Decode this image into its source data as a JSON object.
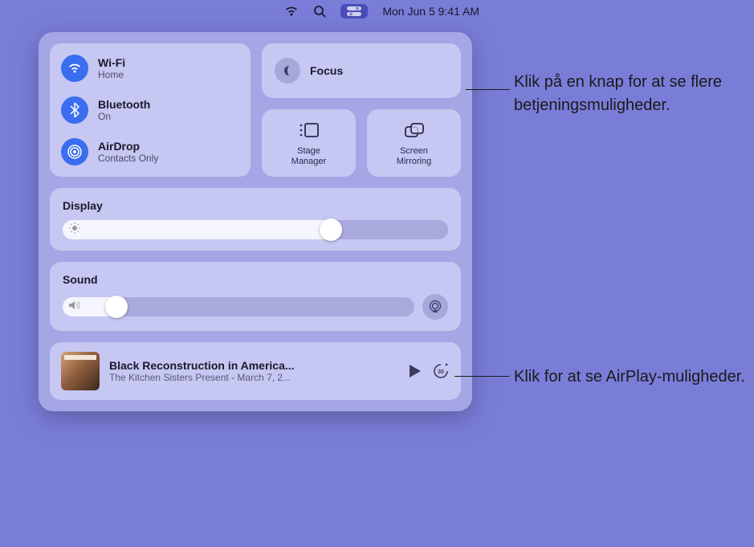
{
  "menubar": {
    "datetime": "Mon Jun 5  9:41 AM"
  },
  "connectivity": {
    "wifi": {
      "title": "Wi-Fi",
      "status": "Home"
    },
    "bluetooth": {
      "title": "Bluetooth",
      "status": "On"
    },
    "airdrop": {
      "title": "AirDrop",
      "status": "Contacts Only"
    }
  },
  "focus": {
    "label": "Focus"
  },
  "stage_manager": {
    "label": "Stage\nManager"
  },
  "screen_mirroring": {
    "label": "Screen\nMirroring"
  },
  "display": {
    "title": "Display",
    "value_percent": 72
  },
  "sound": {
    "title": "Sound",
    "value_percent": 18
  },
  "media": {
    "title": "Black Reconstruction in America...",
    "subtitle": "The Kitchen Sisters Present - March 7, 2..."
  },
  "callouts": {
    "c1": "Klik på en knap for at se flere betjeningsmuligheder.",
    "c2": "Klik for at se AirPlay-muligheder."
  },
  "colors": {
    "accent_blue": "#3a6df0",
    "panel_bg": "rgba(200,200,240,0.55)"
  }
}
